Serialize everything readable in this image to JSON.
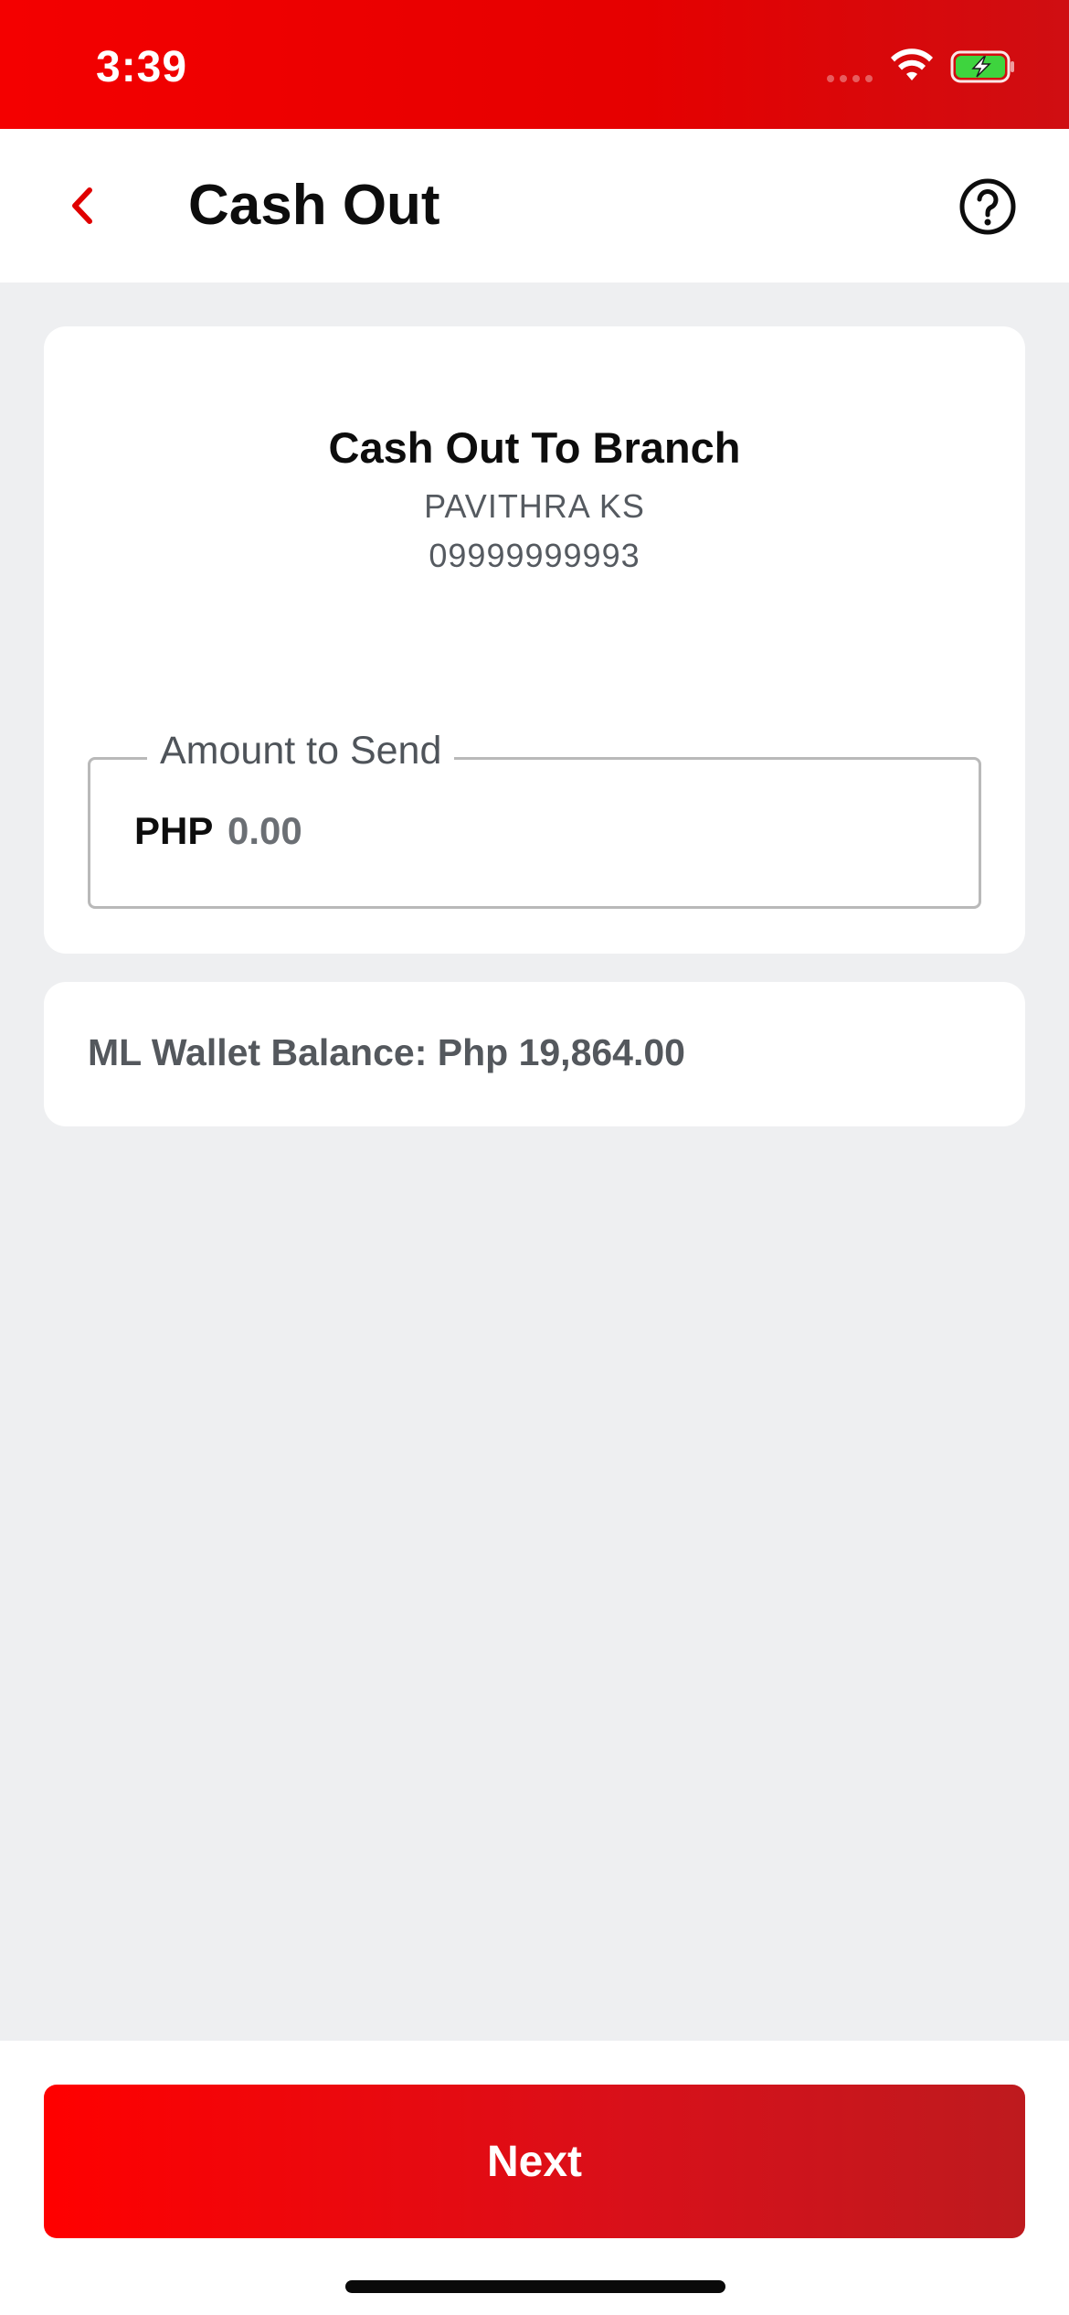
{
  "status_bar": {
    "time": "3:39",
    "icons": [
      "signal-icon",
      "wifi-icon",
      "battery-charging-icon"
    ]
  },
  "header": {
    "title": "Cash Out",
    "back_icon": "chevron-left-icon",
    "help_icon": "help-circle-icon"
  },
  "recipient": {
    "title": "Cash Out To Branch",
    "name": "PAVITHRA KS",
    "phone": "09999999993"
  },
  "amount": {
    "label": "Amount to Send",
    "currency": "PHP",
    "placeholder": "0.00"
  },
  "balance": {
    "text": "ML Wallet Balance: Php 19,864.00"
  },
  "actions": {
    "next_label": "Next"
  },
  "colors": {
    "brand_red": "#e50000",
    "button_red": "#d8101a",
    "background": "#eeeff1"
  }
}
